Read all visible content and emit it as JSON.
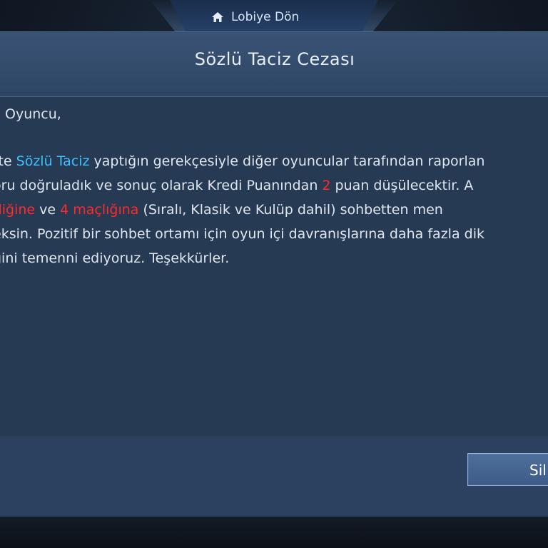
{
  "header": {
    "lobby_label": "Lobiye Dön",
    "icon": "home-icon"
  },
  "dialog": {
    "title": "Sözlü Taciz Cezası",
    "message": {
      "greeting": "Oyuncu,",
      "line1": {
        "a": "tte ",
        "b": "Sözlü Taciz",
        "c": " yaptığın gerekçesiyle diğer oyuncular tarafından raporlan"
      },
      "line2": {
        "a": "oru doğruladık ve sonuç olarak Kredi Puanından ",
        "b": "2",
        "c": " puan düşülecektir. A"
      },
      "line3": {
        "a": "tliğine",
        "b": " ve ",
        "c": "4 maçlığına",
        "d": " (Sıralı, Klasik ve Kulüp dahil) sohbetten men"
      },
      "line4": "eksin. Pozitif bir sohbet ortamı için oyun içi davranışlarına daha fazla dik",
      "line5": "ğini temenni ediyoruz. Teşekkürler."
    },
    "delete_label": "Sil"
  },
  "colors": {
    "highlight_blue": "#3fc1ff",
    "highlight_red": "#ff2a2a",
    "panel": "#2b3e58"
  }
}
